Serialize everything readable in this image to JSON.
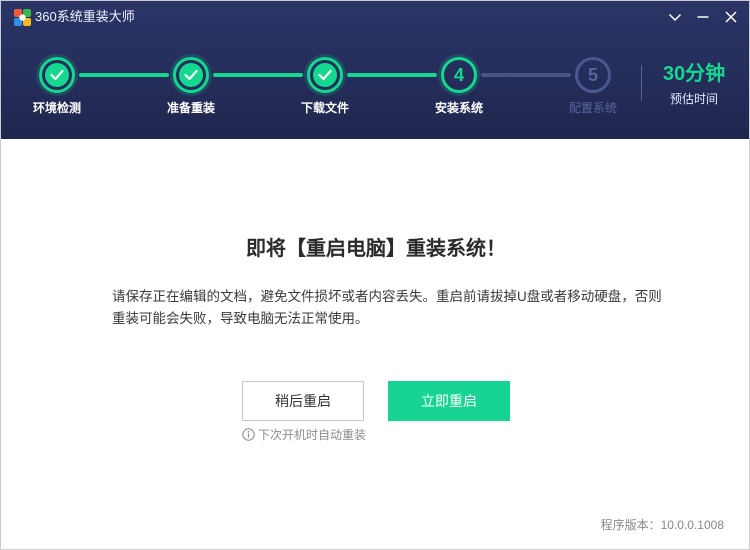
{
  "window": {
    "title": "360系统重装大师",
    "icons": {
      "logo": "app-logo-icon",
      "menu": "chevron-down-icon",
      "minimize": "minimize-icon",
      "close": "close-icon"
    }
  },
  "steps": [
    {
      "label": "环境检测",
      "status": "done"
    },
    {
      "label": "准备重装",
      "status": "done"
    },
    {
      "label": "下载文件",
      "status": "done"
    },
    {
      "label": "安装系统",
      "status": "active",
      "number": "4"
    },
    {
      "label": "配置系统",
      "status": "pending",
      "number": "5"
    }
  ],
  "eta": {
    "value": "30分钟",
    "label": "预估时间"
  },
  "main": {
    "headline": "即将【重启电脑】重装系统！",
    "description": "请保存正在编辑的文档，避免文件损坏或者内容丢失。重启前请拔掉U盘或者移动硬盘，否则重装可能会失败，导致电脑无法正常使用。",
    "later_button": "稍后重启",
    "now_button": "立即重启",
    "hint": "下次开机时自动重装"
  },
  "footer": {
    "version": "程序版本：10.0.0.1008"
  },
  "colors": {
    "header_bg": "#252d5a",
    "accent": "#18d492",
    "pending": "#5b649c"
  }
}
